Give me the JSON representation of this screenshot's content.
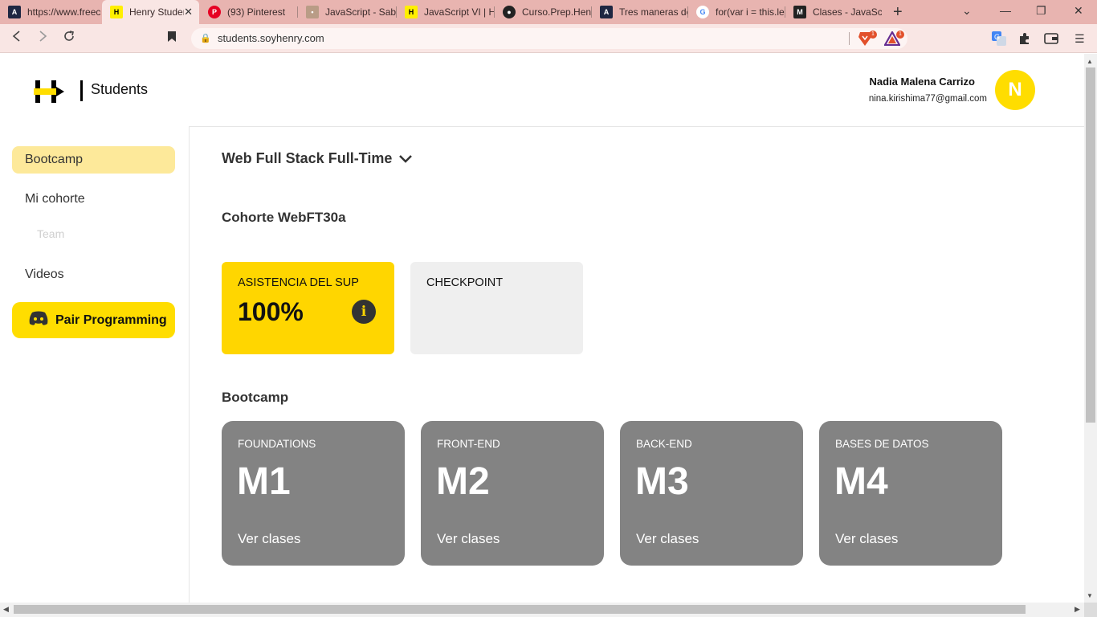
{
  "browser": {
    "tabs": [
      {
        "title": "https://www.freecodecamp.org",
        "icon": "afs-icon"
      },
      {
        "title": "Henry Students",
        "icon": "henry-icon"
      },
      {
        "title": "(93) Pinterest",
        "icon": "pinterest-icon"
      },
      {
        "title": "JavaScript - Saber",
        "icon": "avatar-icon"
      },
      {
        "title": "JavaScript VI | Henry",
        "icon": "henry-icon"
      },
      {
        "title": "Curso.Prep.Henry",
        "icon": "github-icon"
      },
      {
        "title": "Tres maneras de",
        "icon": "afs-icon"
      },
      {
        "title": "for(var i = this.le",
        "icon": "google-icon"
      },
      {
        "title": "Clases - JavaScript",
        "icon": "m-icon"
      }
    ],
    "url": "students.soyhenry.com",
    "brave_badge": "1",
    "rewards_badge": "1"
  },
  "header": {
    "brand": "Students",
    "user_name": "Nadia Malena Carrizo",
    "user_email": "nina.kirishima77@gmail.com",
    "avatar_initial": "N"
  },
  "sidebar": {
    "items": [
      {
        "label": "Bootcamp",
        "active": true
      },
      {
        "label": "Mi cohorte"
      },
      {
        "label": "Team"
      },
      {
        "label": "Videos"
      }
    ],
    "pair_button": "Pair Programming"
  },
  "main": {
    "program": "Web Full Stack Full-Time",
    "cohort": "Cohorte WebFT30a",
    "stats": [
      {
        "label": "ASISTENCIA DEL SUP",
        "value": "100%"
      },
      {
        "label": "CHECKPOINT",
        "value": ""
      }
    ],
    "section_title": "Bootcamp",
    "modules": [
      {
        "subtitle": "FOUNDATIONS",
        "code": "M1",
        "link": "Ver clases"
      },
      {
        "subtitle": "FRONT-END",
        "code": "M2",
        "link": "Ver clases"
      },
      {
        "subtitle": "BACK-END",
        "code": "M3",
        "link": "Ver clases"
      },
      {
        "subtitle": "BASES DE DATOS",
        "code": "M4",
        "link": "Ver clases"
      }
    ]
  },
  "colors": {
    "accent": "#ffdd00",
    "active_nav": "#fde99a",
    "module_card": "#838383",
    "tabbar": "#e8b4b0"
  }
}
